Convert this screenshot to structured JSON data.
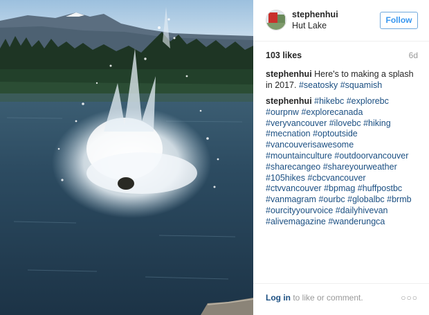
{
  "post": {
    "author": "stephenhui",
    "location": "Hut Lake",
    "follow_label": "Follow",
    "likes": "103 likes",
    "age": "6d"
  },
  "caption": {
    "user": "stephenhui",
    "text": " Here's to making a splash in 2017. ",
    "tags": [
      "#seatosky",
      "#squamish"
    ]
  },
  "hashtag_comment": {
    "user": "stephenhui",
    "tags": [
      "#hikebc",
      "#explorebc",
      "#ourpnw",
      "#explorecanada",
      "#veryvancouver",
      "#ilovebc",
      "#hiking",
      "#mecnation",
      "#optoutside",
      "#vancouverisawesome",
      "#mountainculture",
      "#outdoorvancouver",
      "#sharecangeo",
      "#shareyourweather",
      "#105hikes",
      "#cbcvancouver",
      "#ctvvancouver",
      "#bpmag",
      "#huffpostbc",
      "#vanmagram",
      "#ourbc",
      "#globalbc",
      "#brmb",
      "#ourcityyourvoice",
      "#dailyhivevan",
      "#alivemagazine",
      "#wanderungca"
    ]
  },
  "footer": {
    "login_label": "Log in",
    "login_rest": " to like or comment.",
    "more_icon": "more-options-icon"
  },
  "colors": {
    "link": "#1b4f82",
    "follow": "#3897f0",
    "muted": "#999999"
  }
}
